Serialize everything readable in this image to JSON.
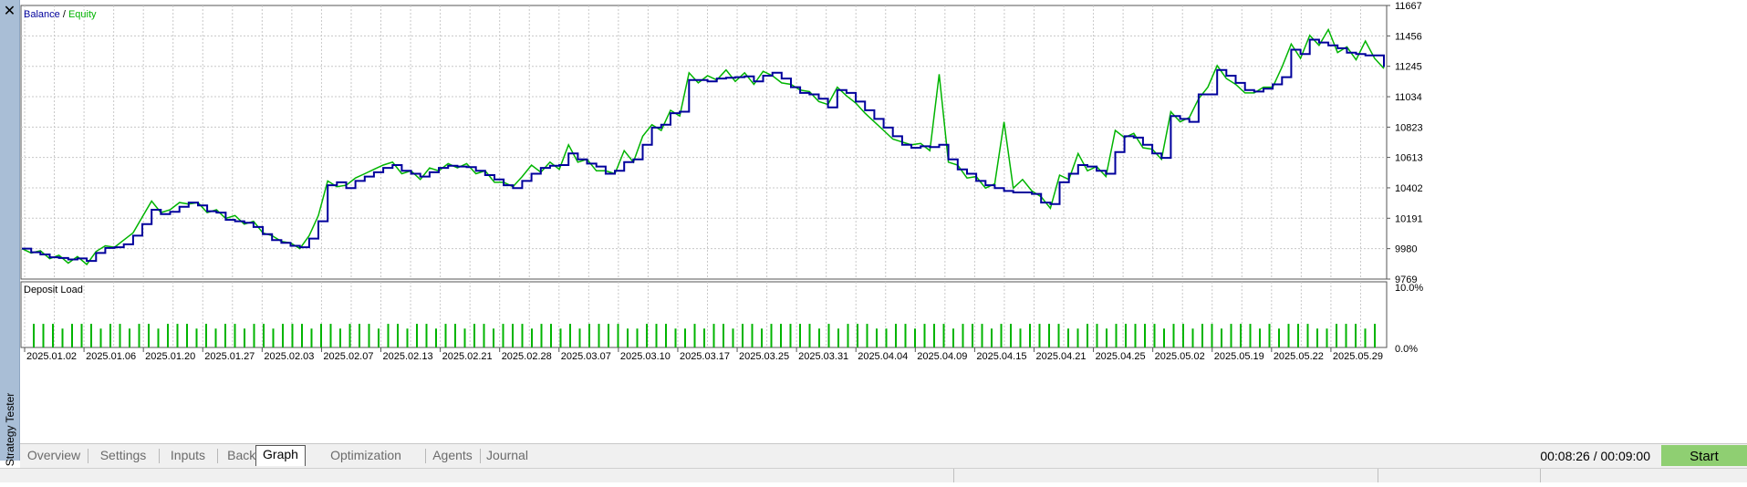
{
  "panel": {
    "vertical_title": "Strategy Tester",
    "close_icon": "close-icon"
  },
  "chart_data": [
    {
      "type": "line",
      "title": "",
      "legend": [
        "Balance",
        "Equity"
      ],
      "legend_separator": " / ",
      "colors": {
        "balance": "#00009c",
        "equity": "#00b400",
        "grid": "#c8c8c8"
      },
      "grid": true,
      "ylim": [
        9769,
        11667
      ],
      "y_ticks": [
        11667,
        11456,
        11245,
        11034,
        10823,
        10613,
        10402,
        10191,
        9980,
        9769
      ],
      "x_ticks": [
        "2025.01.02",
        "2025.01.06",
        "2025.01.20",
        "2025.01.27",
        "2025.02.03",
        "2025.02.07",
        "2025.02.13",
        "2025.02.21",
        "2025.02.28",
        "2025.03.07",
        "2025.03.10",
        "2025.03.17",
        "2025.03.25",
        "2025.03.31",
        "2025.04.04",
        "2025.04.09",
        "2025.04.15",
        "2025.04.21",
        "2025.04.25",
        "2025.05.02",
        "2025.05.19",
        "2025.05.22",
        "2025.05.29"
      ],
      "balance": [
        9980,
        9955,
        9940,
        9920,
        9915,
        9905,
        9912,
        9895,
        9950,
        9985,
        9990,
        10010,
        10070,
        10150,
        10250,
        10220,
        10235,
        10270,
        10300,
        10280,
        10240,
        10230,
        10180,
        10170,
        10160,
        10130,
        10080,
        10040,
        10020,
        10000,
        9990,
        10050,
        10170,
        10420,
        10440,
        10400,
        10450,
        10480,
        10510,
        10540,
        10560,
        10520,
        10500,
        10480,
        10510,
        10540,
        10555,
        10550,
        10545,
        10520,
        10490,
        10460,
        10420,
        10400,
        10450,
        10500,
        10540,
        10555,
        10560,
        10640,
        10600,
        10570,
        10550,
        10500,
        10520,
        10580,
        10600,
        10700,
        10820,
        10840,
        10920,
        10930,
        11150,
        11150,
        11140,
        11160,
        11165,
        11170,
        11175,
        11140,
        11180,
        11200,
        11160,
        11100,
        11060,
        11050,
        11020,
        10960,
        11080,
        11060,
        11000,
        10940,
        10880,
        10820,
        10760,
        10700,
        10680,
        10690,
        10685,
        10700,
        10600,
        10530,
        10500,
        10450,
        10420,
        10400,
        10380,
        10370,
        10370,
        10360,
        10300,
        10290,
        10440,
        10500,
        10560,
        10550,
        10520,
        10500,
        10650,
        10760,
        10750,
        10700,
        10640,
        10610,
        10900,
        10880,
        10860,
        11050,
        11050,
        11220,
        11180,
        11130,
        11080,
        11070,
        11090,
        11120,
        11170,
        11360,
        11330,
        11430,
        11410,
        11390,
        11370,
        11340,
        11330,
        11320,
        11320,
        11240
      ],
      "equity": [
        9980,
        9950,
        9965,
        9910,
        9935,
        9880,
        9925,
        9870,
        9960,
        10000,
        9990,
        10040,
        10090,
        10200,
        10310,
        10230,
        10250,
        10300,
        10290,
        10300,
        10230,
        10250,
        10190,
        10210,
        10150,
        10170,
        10090,
        10070,
        10030,
        10020,
        9980,
        10070,
        10210,
        10450,
        10410,
        10420,
        10470,
        10500,
        10530,
        10560,
        10580,
        10500,
        10520,
        10460,
        10540,
        10520,
        10570,
        10540,
        10570,
        10500,
        10520,
        10440,
        10440,
        10410,
        10480,
        10560,
        10510,
        10580,
        10530,
        10700,
        10580,
        10600,
        10520,
        10520,
        10500,
        10660,
        10580,
        10760,
        10840,
        10800,
        10940,
        10900,
        11200,
        11130,
        11180,
        11150,
        11220,
        11140,
        11200,
        11120,
        11210,
        11180,
        11130,
        11120,
        11080,
        11070,
        11000,
        10980,
        11100,
        11040,
        10990,
        10920,
        10860,
        10800,
        10740,
        10720,
        10700,
        10710,
        10660,
        11190,
        10580,
        10560,
        10470,
        10480,
        10400,
        10430,
        10860,
        10400,
        10460,
        10380,
        10340,
        10260,
        10490,
        10460,
        10640,
        10520,
        10550,
        10480,
        10800,
        10750,
        10780,
        10680,
        10670,
        10600,
        10930,
        10860,
        10890,
        11020,
        11100,
        11250,
        11160,
        11120,
        11060,
        11060,
        11100,
        11100,
        11240,
        11400,
        11300,
        11460,
        11390,
        11500,
        11340,
        11380,
        11290,
        11420,
        11300,
        11230
      ]
    },
    {
      "type": "bar",
      "title": "Deposit Load",
      "ylim": [
        0,
        10
      ],
      "y_ticks": [
        "10.0%",
        "0.0%"
      ],
      "color": "#00b400",
      "values": [
        5,
        5,
        5,
        4,
        5,
        5,
        5,
        4,
        5,
        5,
        4,
        5,
        5,
        4,
        5,
        5,
        5,
        4,
        5,
        4,
        5,
        5,
        4,
        5,
        5,
        4,
        5,
        5,
        5,
        4,
        5,
        5,
        4,
        5,
        5,
        5,
        4,
        5,
        5,
        4,
        5,
        5,
        4,
        5,
        5,
        4,
        5,
        5,
        4,
        5,
        5,
        5,
        4,
        5,
        5,
        4,
        5,
        4,
        5,
        5,
        5,
        5,
        4,
        4,
        5,
        5,
        5,
        4,
        4,
        5,
        4,
        5,
        5,
        4,
        5,
        5,
        4,
        5,
        5,
        5,
        5,
        5,
        4,
        5,
        4,
        5,
        5,
        5,
        4,
        4,
        5,
        5,
        4,
        5,
        5,
        5,
        4,
        5,
        5,
        5,
        4,
        5,
        5,
        4,
        5,
        5,
        5,
        5,
        4,
        4,
        5,
        5,
        4,
        5,
        5,
        5,
        5,
        5,
        4,
        5,
        5,
        4,
        5,
        5,
        4,
        5,
        5,
        5,
        4,
        5,
        4,
        5,
        5,
        5,
        4,
        4,
        5,
        5,
        5,
        4,
        5
      ]
    }
  ],
  "tabs": [
    {
      "label": "Overview",
      "active": false
    },
    {
      "label": "Settings",
      "active": false
    },
    {
      "label": "Inputs",
      "active": false
    },
    {
      "label": "Backtest",
      "active": false
    },
    {
      "label": "Graph",
      "active": true
    },
    {
      "label": "Optimization Results",
      "active": false
    },
    {
      "label": "Agents",
      "active": false
    },
    {
      "label": "Journal",
      "active": false
    }
  ],
  "timer": "00:08:26 / 00:09:00",
  "start_label": "Start"
}
